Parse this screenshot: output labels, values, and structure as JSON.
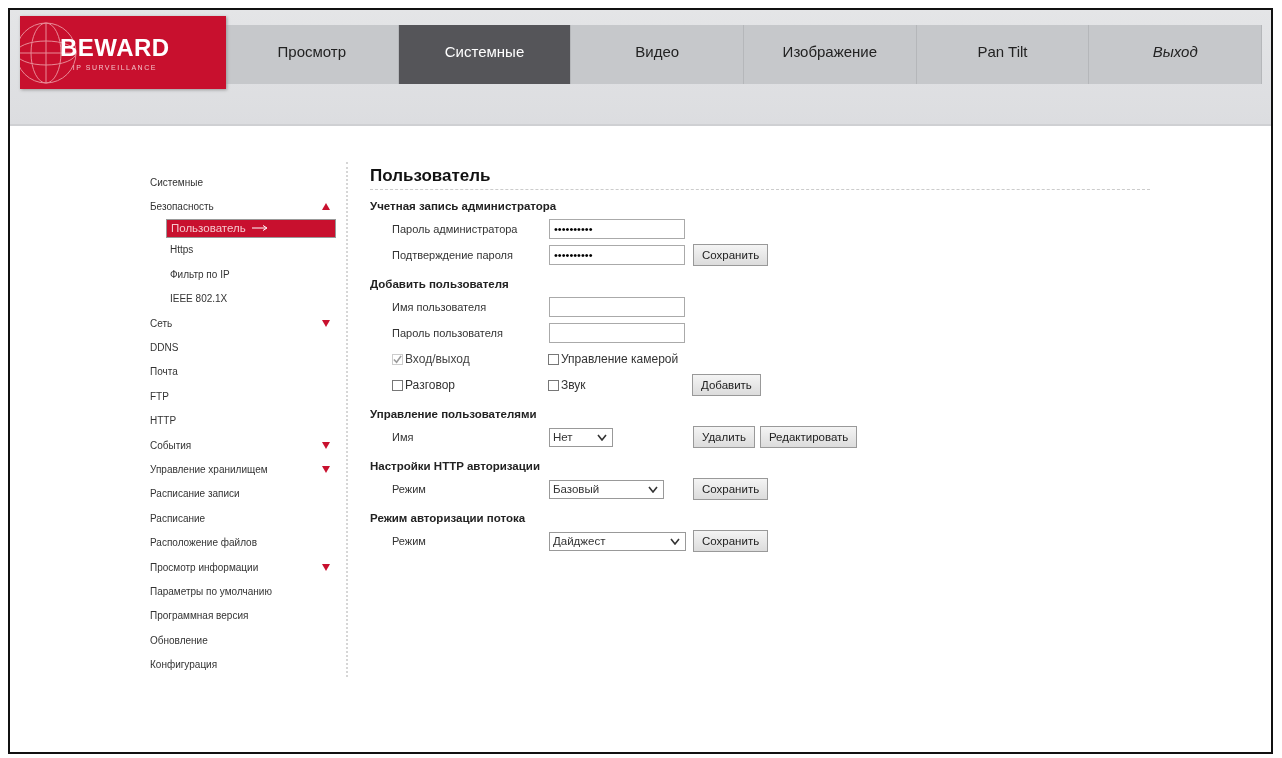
{
  "logo": {
    "brand": "BEWARD",
    "tagline": "IP SURVEILLANCE"
  },
  "nav": [
    {
      "label": "Просмотр",
      "selected": false,
      "kind": "page"
    },
    {
      "label": "Системные",
      "selected": true,
      "kind": "page"
    },
    {
      "label": "Видео",
      "selected": false,
      "kind": "page"
    },
    {
      "label": "Изображение",
      "selected": false,
      "kind": "page"
    },
    {
      "label": "Pan Tilt",
      "selected": false,
      "kind": "page"
    },
    {
      "label": "Выход",
      "selected": false,
      "kind": "exit"
    }
  ],
  "sidebar": {
    "items": [
      {
        "label": "Системные",
        "selected": false
      },
      {
        "label": "Безопасность",
        "selected": false,
        "expanded": true,
        "children": [
          {
            "label": "Пользователь",
            "selected": true
          },
          {
            "label": "Https",
            "selected": false
          },
          {
            "label": "Фильтр по IP",
            "selected": false
          },
          {
            "label": "IEEE 802.1X",
            "selected": false
          }
        ]
      },
      {
        "label": "Сеть",
        "selected": false,
        "expanded": false
      },
      {
        "label": "DDNS",
        "selected": false
      },
      {
        "label": "Почта",
        "selected": false
      },
      {
        "label": "FTP",
        "selected": false
      },
      {
        "label": "HTTP",
        "selected": false
      },
      {
        "label": "События",
        "selected": false,
        "expanded": false
      },
      {
        "label": "Управление хранилищем",
        "selected": false,
        "expanded": false
      },
      {
        "label": "Расписание записи",
        "selected": false
      },
      {
        "label": "Расписание",
        "selected": false
      },
      {
        "label": "Расположение файлов",
        "selected": false
      },
      {
        "label": "Просмотр информации",
        "selected": false,
        "expanded": false
      },
      {
        "label": "Параметры по умолчанию",
        "selected": false
      },
      {
        "label": "Программная версия",
        "selected": false
      },
      {
        "label": "Обновление",
        "selected": false
      },
      {
        "label": "Конфигурация",
        "selected": false
      }
    ]
  },
  "title": "Пользователь",
  "sections": [
    {
      "heading": "Учетная запись администратора",
      "rows": [
        {
          "kind": "field",
          "label": "Пароль администратора",
          "value": "••••••••••"
        },
        {
          "kind": "field",
          "label": "Подтверждение пароля",
          "value": "••••••••••",
          "buttons": [
            "Сохранить"
          ]
        }
      ]
    },
    {
      "heading": "Добавить пользователя",
      "rows": [
        {
          "kind": "field",
          "label": "Имя пользователя",
          "value": ""
        },
        {
          "kind": "field",
          "label": "Пароль пользователя",
          "value": ""
        },
        {
          "kind": "checks",
          "checks": [
            {
              "label": "Вход/выход",
              "checked": true,
              "disabled": true
            },
            {
              "label": "Управление камерой",
              "checked": false,
              "disabled": false
            }
          ]
        },
        {
          "kind": "checks",
          "checks": [
            {
              "label": "Разговор",
              "checked": false,
              "disabled": false
            },
            {
              "label": "Звук",
              "checked": false,
              "disabled": false
            }
          ],
          "buttons": [
            "Добавить"
          ]
        }
      ]
    },
    {
      "heading": "Управление пользователями",
      "rows": [
        {
          "kind": "select",
          "label": "Имя",
          "value": "Нет",
          "buttons": [
            "Удалить",
            "Редактировать"
          ]
        }
      ]
    },
    {
      "heading": "Настройки HTTP авторизации",
      "rows": [
        {
          "kind": "select",
          "label": "Режим",
          "value": "Базовый",
          "buttons": [
            "Сохранить"
          ]
        }
      ]
    },
    {
      "heading": "Режим авторизации потока",
      "rows": [
        {
          "kind": "select",
          "label": "Режим",
          "value": "Дайджест",
          "buttons": [
            "Сохранить"
          ]
        }
      ]
    }
  ]
}
